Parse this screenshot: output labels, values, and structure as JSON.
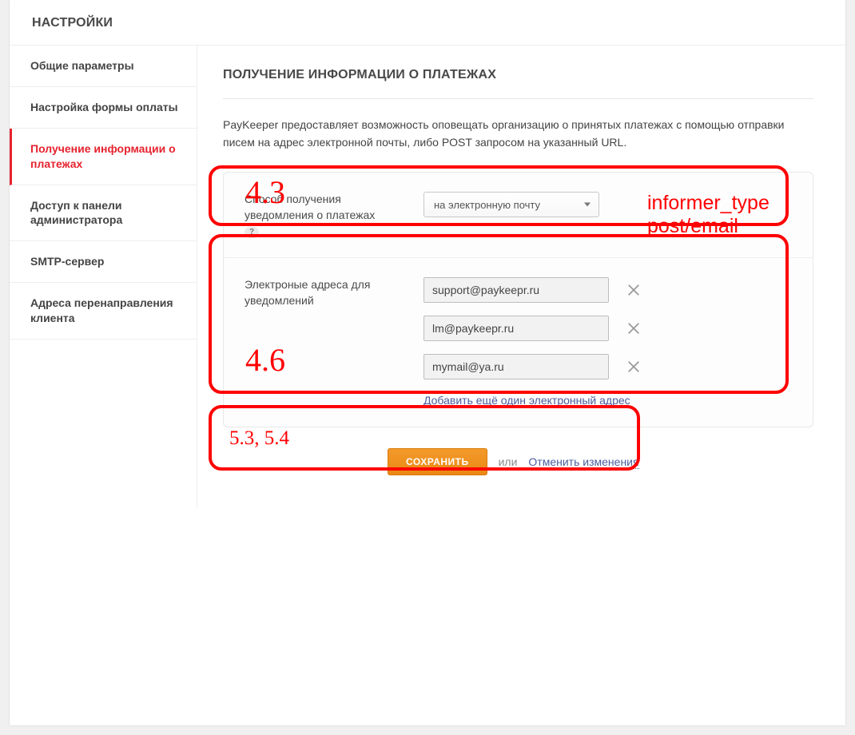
{
  "page": {
    "app_title": "НАСТРОЙКИ",
    "section_title": "ПОЛУЧЕНИЕ ИНФОРМАЦИИ О ПЛАТЕЖАХ",
    "intro": "PayKeeper предоставляет возможность оповещать организацию о принятых платежах с помощью отправки писем на адрес электронной почты, либо POST запросом на указанный URL."
  },
  "sidebar": {
    "items": [
      {
        "label": "Общие параметры"
      },
      {
        "label": "Настройка формы оплаты"
      },
      {
        "label": "Получение информации о платежах",
        "active": true
      },
      {
        "label": "Доступ к панели администратора"
      },
      {
        "label": "SMTP-сервер"
      },
      {
        "label": "Адреса перенаправления клиента"
      }
    ]
  },
  "method_row": {
    "label": "Способ получения уведомления о платежах",
    "help_icon": "?",
    "select_value": "на электронную почту",
    "side_note": "informer_type post/email"
  },
  "emails_row": {
    "label": "Электроные адреса для уведомлений",
    "emails": [
      "support@paykeepr.ru",
      "lm@paykeepr.ru",
      "mymail@ya.ru"
    ],
    "add_link": "Добавить ещё один электронный адрес"
  },
  "footer": {
    "save_label": "СОХРАНИТЬ",
    "or_word": "или",
    "cancel_label": "Отменить изменения"
  },
  "annotations": {
    "box1_label": "4.3",
    "box2_label": "4.6",
    "box3_label": "5.3, 5.4"
  },
  "colors": {
    "accent_red": "#e6232e",
    "primary_orange": "#ee8d18",
    "link_blue": "#4b5d9c",
    "annotation_red": "#ff0000"
  }
}
